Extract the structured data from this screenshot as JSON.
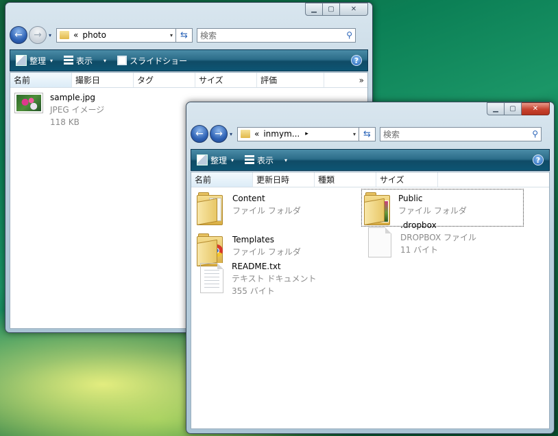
{
  "window1": {
    "address": "photo",
    "address_prefix": "«",
    "search_placeholder": "検索",
    "toolbar": {
      "organize": "整理",
      "view": "表示",
      "slideshow": "スライドショー"
    },
    "columns": [
      "名前",
      "撮影日",
      "タグ",
      "サイズ",
      "評価"
    ],
    "more": "»",
    "files": [
      {
        "name": "sample.jpg",
        "type": "JPEG イメージ",
        "size": "118 KB"
      }
    ]
  },
  "window2": {
    "address": "inmym...",
    "address_prefix": "«",
    "search_placeholder": "検索",
    "toolbar": {
      "organize": "整理",
      "view": "表示"
    },
    "columns": [
      "名前",
      "更新日時",
      "種類",
      "サイズ"
    ],
    "items": [
      {
        "name": "Content",
        "type": "ファイル フォルダ",
        "icon": "folder-icon"
      },
      {
        "name": "Public",
        "type": "ファイル フォルダ",
        "icon": "folder-photo-icon"
      },
      {
        "name": "Templates",
        "type": "ファイル フォルダ",
        "icon": "folder-chrome-icon"
      },
      {
        "name": ".dropbox",
        "type": "DROPBOX ファイル",
        "size": "11 バイト",
        "icon": "blank-file-icon"
      },
      {
        "name": "README.txt",
        "type": "テキスト ドキュメント",
        "size": "355 バイト",
        "icon": "text-file-icon"
      }
    ]
  },
  "glyphs": {
    "back": "←",
    "forward": "→",
    "dropdown": "▾",
    "refresh": "⇆",
    "search": "⚲",
    "help": "?",
    "minimize": "▁",
    "maximize": "▢",
    "close": "✕"
  }
}
